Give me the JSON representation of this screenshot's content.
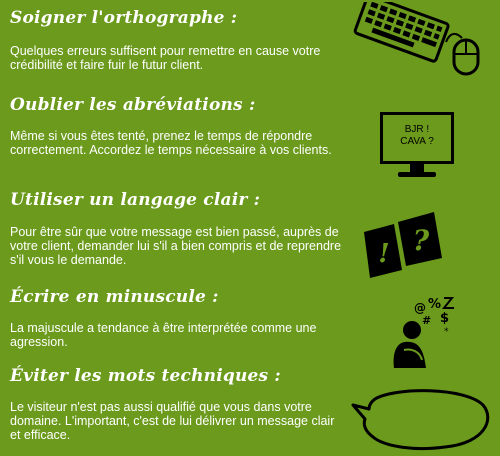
{
  "sections": [
    {
      "title": "Soigner l'orthographe :",
      "text": "Quelques erreurs suffisent pour remettre en cause votre crédibilité et faire fuir le futur client.",
      "icon": "keyboard-mouse-icon"
    },
    {
      "title": "Oublier les abréviations :",
      "text": "Même si vous êtes tenté, prenez le temps de répondre correctement. Accordez le temps nécessaire à vos clients.",
      "icon": "monitor-icon",
      "screen_text": [
        "BJR !",
        "CAVA ?"
      ]
    },
    {
      "title": "Utiliser un langage clair :",
      "text": "Pour être sûr que votre message est bien passé, auprès de votre client, demander lui s'il a bien compris et de reprendre s'il vous le demande.",
      "icon": "exclamation-question-icon"
    },
    {
      "title": "Écrire en minuscule :",
      "text": "La majuscule a tendance à être interprétée comme une agression.",
      "icon": "angry-person-icon"
    },
    {
      "title": "Éviter les mots techniques :",
      "text": "Le visiteur n'est pas aussi qualifié que vous dans votre domaine. L'important, c'est de lui délivrer un message clair et efficace.",
      "icon": "speech-bubble-icon"
    }
  ],
  "colors": {
    "background": "#6b9a1c",
    "text": "#ffffff",
    "ink": "#000000"
  }
}
